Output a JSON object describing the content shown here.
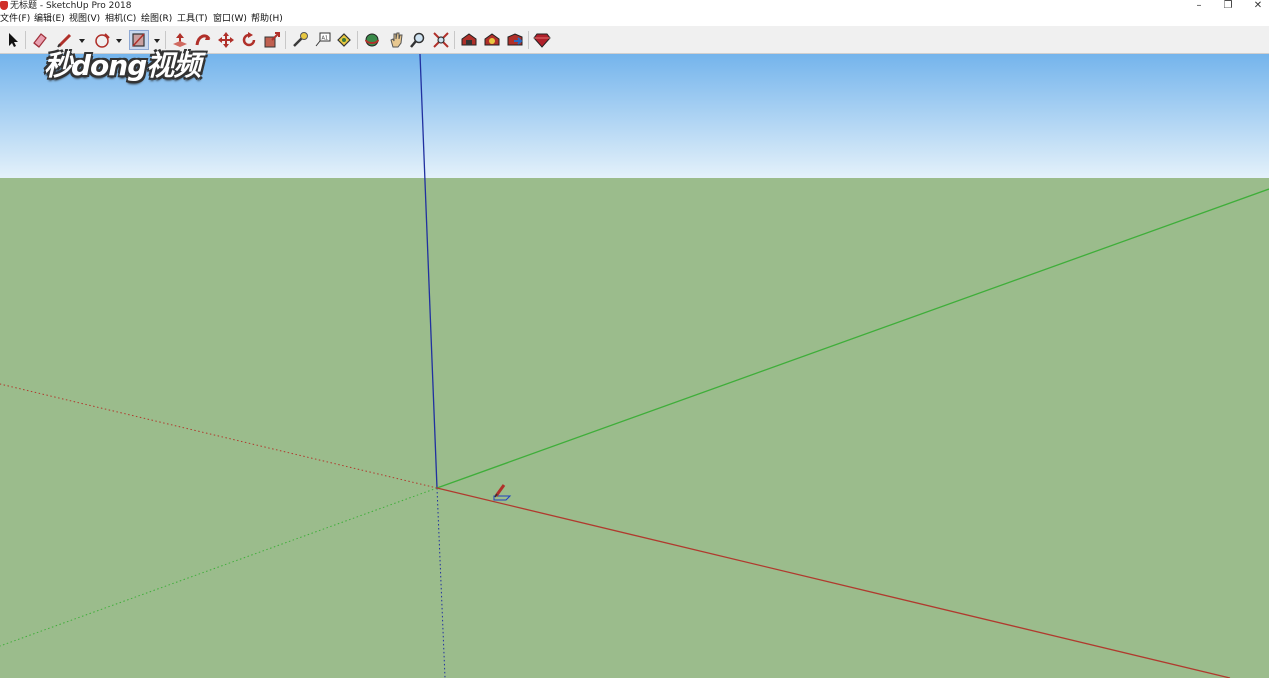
{
  "window": {
    "title": "无标题 - SketchUp Pro 2018",
    "minimize": "–",
    "restore": "❐",
    "close": "✕"
  },
  "menu": [
    "文件(F)",
    "编辑(E)",
    "视图(V)",
    "相机(C)",
    "绘图(R)",
    "工具(T)",
    "窗口(W)",
    "帮助(H)"
  ],
  "toolbar": {
    "icons": [
      "select-arrow-icon",
      "eraser-icon",
      "line-pencil-icon",
      "circle-shape-icon",
      "rectangle-paint-icon",
      "push-pull-icon",
      "follow-me-icon",
      "move-icon",
      "rotate-icon",
      "scale-icon",
      "tape-measure-icon",
      "text-label-icon",
      "paint-bucket-icon",
      "orbit-icon",
      "pan-icon",
      "zoom-icon",
      "zoom-extents-icon",
      "warehouse-icon",
      "extension-warehouse-icon",
      "share-model-icon",
      "ruby-extension-icon"
    ],
    "active": "rectangle-paint-icon"
  },
  "watermark": "秒dong视频",
  "colors": {
    "sky_top": "#74b4ec",
    "sky_bottom": "#e4f1fa",
    "ground": "#9bbc8c",
    "red_axis": "#b03a2e",
    "green_axis": "#3fae3a",
    "blue_axis": "#2030a0"
  }
}
